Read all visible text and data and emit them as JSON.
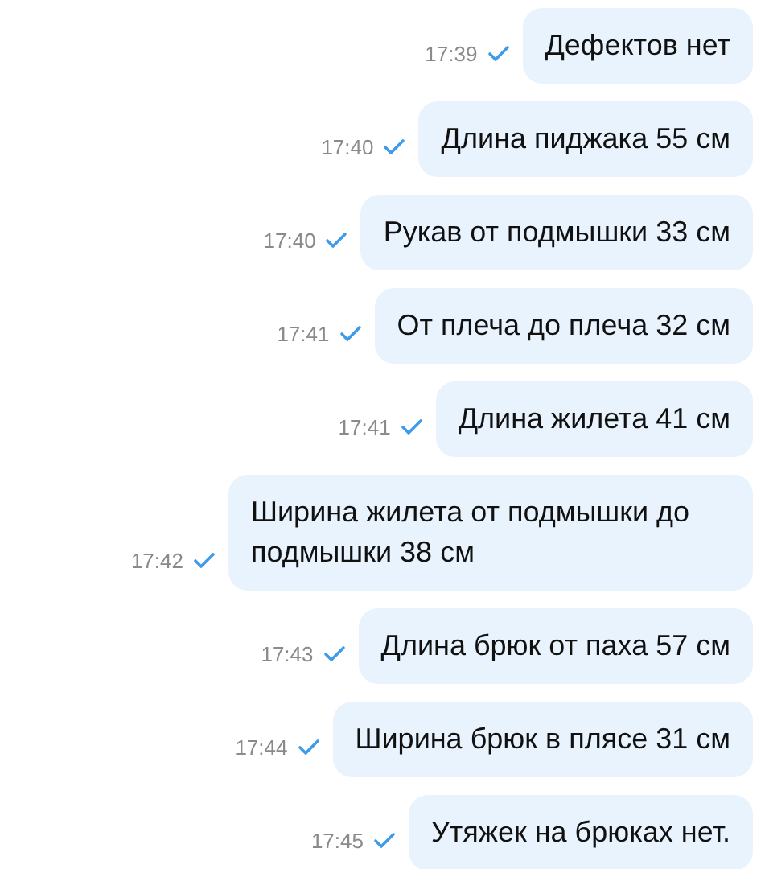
{
  "messages": [
    {
      "text": "Дефектов нет",
      "time": "17:39"
    },
    {
      "text": "Длина пиджака 55 см",
      "time": "17:40"
    },
    {
      "text": "Рукав от подмышки 33 см",
      "time": "17:40"
    },
    {
      "text": "От плеча до плеча 32 см",
      "time": "17:41"
    },
    {
      "text": "Длина жилета 41 см",
      "time": "17:41"
    },
    {
      "text": "Ширина жилета от подмышки до подмышки 38 см",
      "time": "17:42"
    },
    {
      "text": "Длина брюк от паха 57 см",
      "time": "17:43"
    },
    {
      "text": "Ширина брюк в плясе 31 см",
      "time": "17:44"
    },
    {
      "text": "Утяжек на брюках нет.",
      "time": "17:45"
    }
  ]
}
